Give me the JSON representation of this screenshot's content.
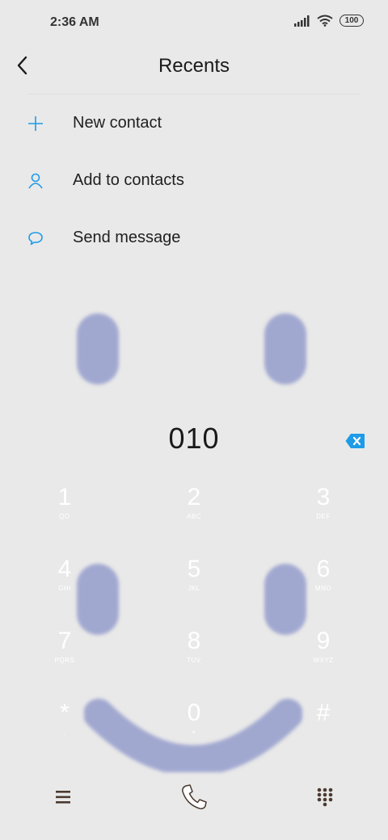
{
  "status_bar": {
    "time": "2:36 AM",
    "battery": "100"
  },
  "header": {
    "title": "Recents"
  },
  "menu": {
    "items": [
      {
        "label": "New contact",
        "icon": "plus-icon"
      },
      {
        "label": "Add to contacts",
        "icon": "person-icon"
      },
      {
        "label": "Send message",
        "icon": "chat-bubble-icon"
      }
    ]
  },
  "dialer": {
    "number": "010"
  },
  "keypad": {
    "keys": [
      {
        "digit": "1",
        "sub": "QO"
      },
      {
        "digit": "2",
        "sub": "ABC"
      },
      {
        "digit": "3",
        "sub": "DEF"
      },
      {
        "digit": "4",
        "sub": "GHI"
      },
      {
        "digit": "5",
        "sub": "JKL"
      },
      {
        "digit": "6",
        "sub": "MNO"
      },
      {
        "digit": "7",
        "sub": "PQRS"
      },
      {
        "digit": "8",
        "sub": "TUV"
      },
      {
        "digit": "9",
        "sub": "WXYZ"
      },
      {
        "digit": "*",
        "sub": ","
      },
      {
        "digit": "0",
        "sub": "+"
      },
      {
        "digit": "#",
        "sub": ""
      }
    ]
  },
  "colors": {
    "accent": "#1e9be8",
    "background": "#e9e9e9",
    "overlay": "#a1a8d0",
    "icon_dark": "#4a3a30"
  }
}
